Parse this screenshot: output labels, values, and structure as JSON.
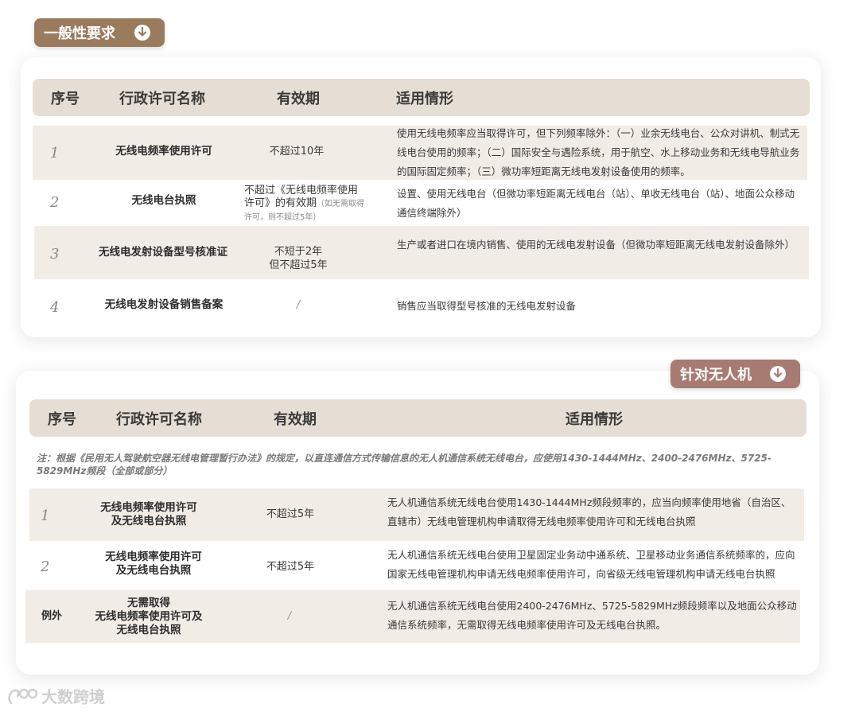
{
  "section1": {
    "tag": "一般性要求",
    "headers": {
      "no": "序号",
      "name": "行政许可名称",
      "valid": "有效期",
      "scope": "适用情形"
    },
    "rows": [
      {
        "no": "1",
        "name": "无线电频率使用许可",
        "valid": "不超过10年",
        "valid_note": "",
        "scope": "使用无线电频率应当取得许可，但下列频率除外：（一）业余无线电台、公众对讲机、制式无线电台使用的频率；（二）国际安全与遇险系统，用于航空、水上移动业务和无线电导航业务的国际固定频率；（三）微功率短距离无线电发射设备使用的频率。"
      },
      {
        "no": "2",
        "name": "无线电台执照",
        "valid": "不超过《无线电频率使用许可》的有效期",
        "valid_note": "（如无需取得许可，则不超过5年）",
        "scope": "设置、使用无线电台（但微功率短距离无线电台（站）、单收无线电台（站）、地面公众移动通信终端除外）"
      },
      {
        "no": "3",
        "name": "无线电发射设备型号核准证",
        "valid": "不短于2年",
        "valid2": "但不超过5年",
        "valid_note": "",
        "scope": "生产或者进口在境内销售、使用的无线电发射设备（但微功率短距离无线电发射设备除外）"
      },
      {
        "no": "4",
        "name": "无线电发射设备销售备案",
        "valid": "/",
        "valid_note": "",
        "scope": "销售应当取得型号核准的无线电发射设备"
      }
    ]
  },
  "section2": {
    "tag": "针对无人机",
    "headers": {
      "no": "序号",
      "name": "行政许可名称",
      "valid": "有效期",
      "scope": "适用情形"
    },
    "note": "注：根据《民用无人驾驶航空器无线电管理暂行办法》的规定，以直连通信方式传输信息的无人机通信系统无线电台，应使用1430-1444MHz、2400-2476MHz、5725-5829MHz频段（全部或部分）",
    "rows": [
      {
        "no": "1",
        "name1": "无线电频率使用许可",
        "name2": "及无线电台执照",
        "name3": "",
        "valid": "不超过5年",
        "scope": "无人机通信系统无线电台使用1430-1444MHz频段频率的，应当向频率使用地省（自治区、直辖市）无线电管理机构申请取得无线电频率使用许可和无线电台执照"
      },
      {
        "no": "2",
        "name1": "无线电频率使用许可",
        "name2": "及无线电台执照",
        "name3": "",
        "valid": "不超过5年",
        "scope": "无人机通信系统无线电台使用卫星固定业务动中通系统、卫星移动业务通信系统频率的，应向国家无线电管理机构申请无线电频率使用许可，向省级无线电管理机构申请无线电台执照"
      },
      {
        "no": "例外",
        "name1": "无需取得",
        "name2": "无线电频率使用许可及",
        "name3": "无线电台执照",
        "valid": "/",
        "scope": "无人机通信系统无线电台使用2400-2476MHz、5725-5829MHz频段频率以及地面公众移动通信系统频率，无需取得无线电频率使用许可及无线电台执照。"
      }
    ]
  },
  "watermark": "大数跨境",
  "colors": {
    "tag1": "#9b7b5e",
    "tag2": "#a87b72",
    "header_bg": "#e6ded5",
    "row_shade": "#f1ece6"
  },
  "icons": {
    "tag_icon": "download-circle-icon",
    "logo_icon": "brand-logo-icon"
  }
}
